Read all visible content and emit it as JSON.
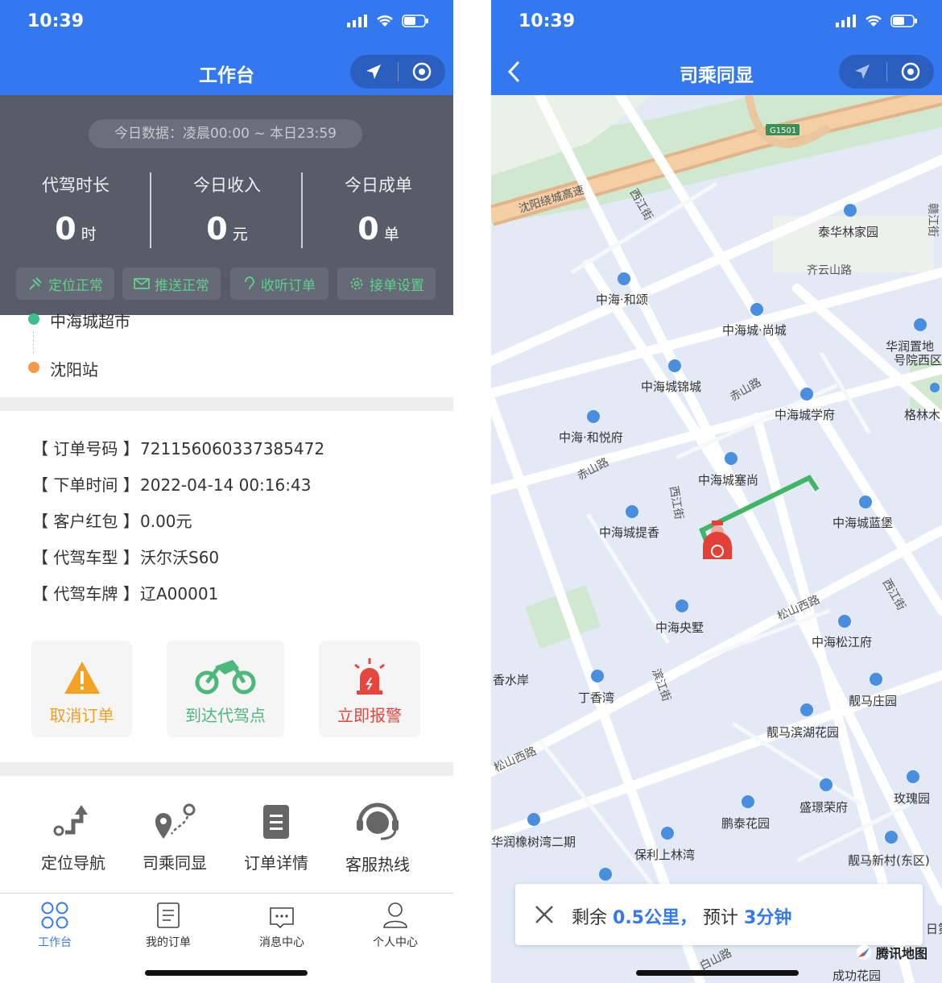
{
  "status_bar": {
    "time": "10:39"
  },
  "left": {
    "title": "工作台",
    "today_range": "今日数据：凌晨00:00 ~ 本日23:59",
    "stats": [
      {
        "label": "代驾时长",
        "value": "0",
        "unit": "时"
      },
      {
        "label": "今日收入",
        "value": "0",
        "unit": "元"
      },
      {
        "label": "今日成单",
        "value": "0",
        "unit": "单"
      }
    ],
    "status_chips": [
      "定位正常",
      "推送正常",
      "收听订单",
      "接单设置"
    ],
    "route": {
      "start": "中海城超市",
      "end": "沈阳站"
    },
    "order_info": [
      {
        "key": "【 订单号码 】",
        "value": "721156060337385472"
      },
      {
        "key": "【 下单时间 】",
        "value": "2022-04-14 00:16:43"
      },
      {
        "key": "【 客户红包 】",
        "value": "0.00元"
      },
      {
        "key": "【 代驾车型 】",
        "value": "沃尔沃S60"
      },
      {
        "key": "【 代驾车牌 】",
        "value": "辽A00001"
      }
    ],
    "actions": [
      {
        "label": "取消订单",
        "color": "#f0a020"
      },
      {
        "label": "到达代驾点",
        "color": "#4cb87a"
      },
      {
        "label": "立即报警",
        "color": "#e8453c"
      }
    ],
    "tools": [
      "定位导航",
      "司乘同显",
      "订单详情",
      "客服热线"
    ],
    "tabs": [
      "工作台",
      "我的订单",
      "消息中心",
      "个人中心"
    ],
    "active_tab_color": "#3478f0"
  },
  "right": {
    "title": "司乘同显",
    "map_labels": {
      "highway": "沈阳绕城高速",
      "highway_shield": "G1501",
      "xijiang": "西江街",
      "ganjiang": "赣江街",
      "taihua": "泰华林家园",
      "qiyunshan": "齐云山路",
      "hesong": "中海·和颂",
      "shangcheng": "中海城·尚城",
      "huarun_top": "华润置地",
      "huarun_top2": "号院西区",
      "jincheng": "中海城锦城",
      "chishan": "赤山路",
      "xuefu": "中海城学府",
      "gelin": "格林木",
      "heyue": "中海·和悦府",
      "chishan2": "赤山路",
      "saishang": "中海城塞尚",
      "xijiang2": "西江街",
      "tixiang": "中海城提香",
      "lanbao": "中海城蓝堡",
      "songshan": "松山西路",
      "xijiang3": "西江街",
      "yangshu": "中海央墅",
      "songjiang": "中海松江府",
      "xiangshui": "香水岸",
      "dingxiang": "丁香湾",
      "binjiang": "滨江街",
      "liangmazhuang": "靓马庄园",
      "liangmahu": "靓马滨湖花园",
      "songshan2": "松山西路",
      "meigui": "玫瑰园",
      "shengjing": "盛璟荣府",
      "pengtai": "鹏泰花园",
      "xiangshu": "华润橡树湾二期",
      "baoli": "保利上林湾",
      "liangmaxin": "靓马新村(东区)",
      "chenggong": "成功花园",
      "baishan": "白山路",
      "ri": "日第"
    },
    "nav": {
      "prefix": "剩余",
      "distance": "0.5",
      "distance_unit": "公里，",
      "eta_prefix": "预计",
      "eta": "3",
      "eta_unit": "分钟"
    },
    "map_brand": "腾讯地图"
  }
}
